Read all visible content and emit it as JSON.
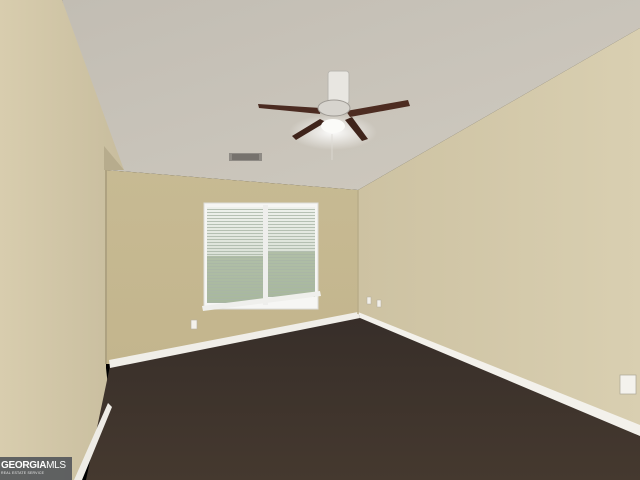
{
  "scene": {
    "description_alt": "",
    "palette": {
      "ceiling": "#c6c2b9",
      "wall_left": "#d3c8a8",
      "wall_back": "#c8bb93",
      "wall_right": "#d2c7a7",
      "carpet": "#3e342e",
      "baseboard": "#f2f0ea",
      "window_frame": "#f4f4f2",
      "fan_blade": "#4a2a20",
      "fan_body": "#e9e7e2"
    }
  },
  "watermark": {
    "brand_bold": "GEORGIA",
    "brand_thin": "MLS",
    "tagline": "REAL ESTATE SERVICE"
  }
}
